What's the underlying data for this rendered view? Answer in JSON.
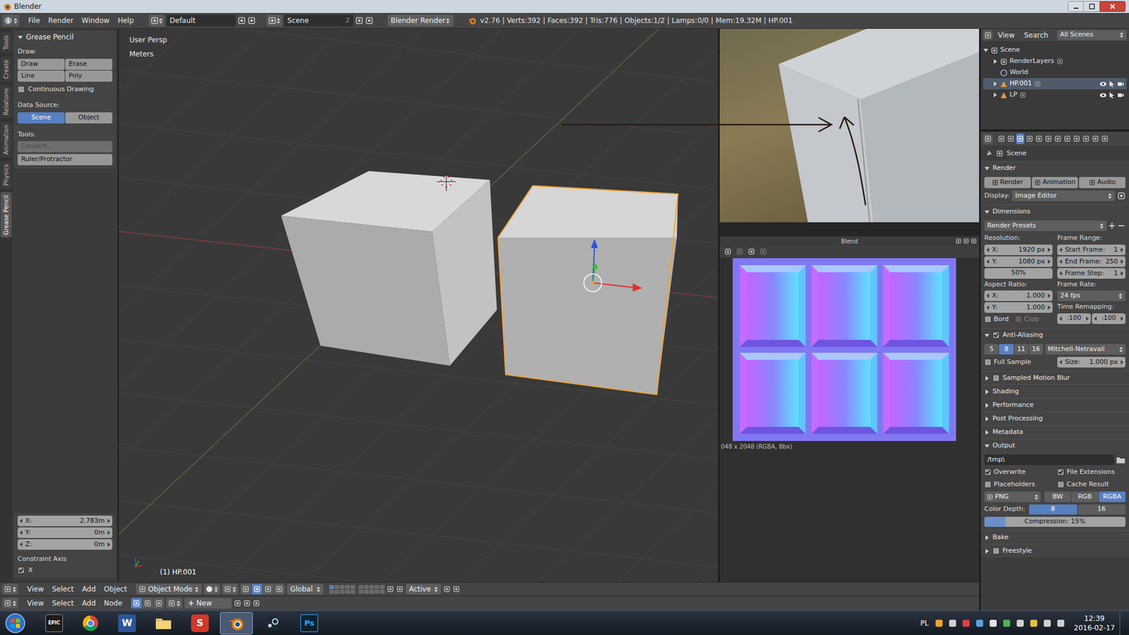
{
  "window": {
    "title": "Blender"
  },
  "info_header": {
    "menus": [
      "File",
      "Render",
      "Window",
      "Help"
    ],
    "layout": "Default",
    "scene": "Scene",
    "scene_users": "2",
    "engine": "Blender Render",
    "stats": "v2.76 | Verts:392 | Faces:392 | Tris:776 | Objects:1/2 | Lamps:0/0 | Mem:19.32M | HP.001"
  },
  "tool_tabs": [
    {
      "label": "Tools",
      "selected": false
    },
    {
      "label": "Create",
      "selected": false
    },
    {
      "label": "Relations",
      "selected": false
    },
    {
      "label": "Animation",
      "selected": false
    },
    {
      "label": "Physics",
      "selected": false
    },
    {
      "label": "Grease Pencil",
      "selected": true
    }
  ],
  "grease_pencil": {
    "title": "Grease Pencil",
    "draw_label": "Draw:",
    "draw_buttons": [
      "Draw",
      "Erase",
      "Line",
      "Poly"
    ],
    "continuous": {
      "label": "Continuous Drawing",
      "checked": false
    },
    "data_source_label": "Data Source:",
    "data_source": [
      {
        "label": "Scene",
        "selected": true
      },
      {
        "label": "Object",
        "selected": false
      }
    ],
    "tools_label": "Tools:",
    "tools": [
      {
        "label": "Convert...",
        "disabled": true
      },
      {
        "label": "Ruler/Protractor",
        "disabled": false
      }
    ]
  },
  "last_operator": {
    "fields": [
      {
        "label": "X:",
        "value": "2.783m"
      },
      {
        "label": "Y:",
        "value": "0m"
      },
      {
        "label": "Z:",
        "value": "0m"
      }
    ],
    "constraint_label": "Constraint Axis",
    "constraint": {
      "label": "X",
      "checked": true
    }
  },
  "viewport": {
    "view": "User Persp",
    "units": "Meters",
    "object_info": "(1) HP.001"
  },
  "image_editor": {
    "title": "Blend",
    "info": "048 x 2048 (RGBA, 8bx)"
  },
  "outliner": {
    "menus": [
      "View",
      "Search"
    ],
    "filter": "All Scenes",
    "scene": {
      "label": "Scene",
      "expanded": true
    },
    "items": [
      {
        "label": "RenderLayers",
        "kind": "renderlayers",
        "expanded": false,
        "selected": false,
        "visible": false
      },
      {
        "label": "World",
        "kind": "world",
        "expanded": false,
        "selected": false,
        "visible": false
      },
      {
        "label": "HP.001",
        "kind": "object",
        "expanded": false,
        "selected": true,
        "visible": true
      },
      {
        "label": "LP",
        "kind": "object",
        "expanded": false,
        "selected": false,
        "visible": true
      }
    ]
  },
  "properties": {
    "context": "Scene",
    "render": {
      "title": "Render",
      "expanded": true,
      "buttons": [
        "Render",
        "Animation",
        "Audio"
      ],
      "display_label": "Display:",
      "display": "Image Editor"
    },
    "dimensions": {
      "title": "Dimensions",
      "expanded": true,
      "presets": "Render Presets",
      "resolution_label": "Resolution:",
      "resolution": [
        {
          "label": "X:",
          "value": "1920 px"
        },
        {
          "label": "Y:",
          "value": "1080 px"
        }
      ],
      "percentage": "50%",
      "frame_range_label": "Frame Range:",
      "frame_range": [
        {
          "label": "Start Frame:",
          "value": "1"
        },
        {
          "label": "End Frame:",
          "value": "250"
        },
        {
          "label": "Frame Step:",
          "value": "1"
        }
      ],
      "aspect_label": "Aspect Ratio:",
      "aspect": [
        {
          "label": "X:",
          "value": "1.000"
        },
        {
          "label": "Y:",
          "value": "1.000"
        }
      ],
      "frame_rate_label": "Frame Rate:",
      "frame_rate": "24 fps",
      "remap_label": "Time Remapping:",
      "remap": [
        ":100",
        ":100"
      ],
      "border": {
        "label": "Bord",
        "checked": false,
        "disabled": false
      },
      "crop": {
        "label": "Crop",
        "checked": false,
        "disabled": true
      }
    },
    "anti_aliasing": {
      "title": "Anti-Aliasing",
      "expanded": true,
      "enabled": true,
      "samples": [
        {
          "label": "5",
          "selected": false
        },
        {
          "label": "8",
          "selected": true
        },
        {
          "label": "11",
          "selected": false
        },
        {
          "label": "16",
          "selected": false
        }
      ],
      "filter": "Mitchell-Netravali",
      "full_sample": {
        "label": "Full Sample",
        "checked": false
      },
      "size": {
        "label": "Size:",
        "value": "1.000 px"
      }
    },
    "collapsed": [
      {
        "title": "Sampled Motion Blur",
        "kind": "toggle",
        "checked": false
      },
      {
        "title": "Shading",
        "kind": "plain",
        "checked": false
      },
      {
        "title": "Performance",
        "kind": "plain",
        "checked": false
      },
      {
        "title": "Post Processing",
        "kind": "plain",
        "checked": false
      },
      {
        "title": "Metadata",
        "kind": "plain",
        "checked": false
      }
    ],
    "output": {
      "title": "Output",
      "expanded": true,
      "path": "/tmp\\",
      "options": [
        {
          "label": "Overwrite",
          "checked": true
        },
        {
          "label": "File Extensions",
          "checked": true
        },
        {
          "label": "Placeholders",
          "checked": false
        },
        {
          "label": "Cache Result",
          "checked": false
        }
      ],
      "format": "PNG",
      "color_modes": [
        {
          "label": "BW",
          "selected": false
        },
        {
          "label": "RGB",
          "selected": false
        },
        {
          "label": "RGBA",
          "selected": true
        }
      ],
      "depth_label": "Color Depth:",
      "depths": [
        {
          "label": "8",
          "selected": true
        },
        {
          "label": "16",
          "selected": false
        }
      ],
      "compression": {
        "label": "Compression:",
        "value": "15%",
        "level": 0.15
      }
    },
    "collapsed_bottom": [
      {
        "title": "Bake",
        "kind": "plain",
        "checked": false
      },
      {
        "title": "Freestyle",
        "kind": "toggle",
        "checked": false
      }
    ]
  },
  "view3d_header": {
    "menus": [
      "View",
      "Select",
      "Add",
      "Object"
    ],
    "mode": "Object Mode",
    "orientation": "Global",
    "pivot": "Active"
  },
  "node_header": {
    "menus": [
      "View",
      "Select",
      "Add",
      "Node"
    ],
    "new": "New"
  },
  "taskbar": {
    "apps": [
      {
        "kind": "epic",
        "label": "EPIC",
        "selected": false
      },
      {
        "kind": "chrome",
        "label": "",
        "selected": false
      },
      {
        "kind": "word",
        "label": "W",
        "selected": false
      },
      {
        "kind": "explorer",
        "label": "",
        "selected": false
      },
      {
        "kind": "red",
        "label": "S",
        "selected": false
      },
      {
        "kind": "blender",
        "label": "",
        "selected": true
      },
      {
        "kind": "steam",
        "label": "",
        "selected": false
      },
      {
        "kind": "photoshop",
        "label": "Ps",
        "selected": false
      }
    ],
    "language": "PL",
    "time": "12:39",
    "date": "2016-02-17"
  }
}
